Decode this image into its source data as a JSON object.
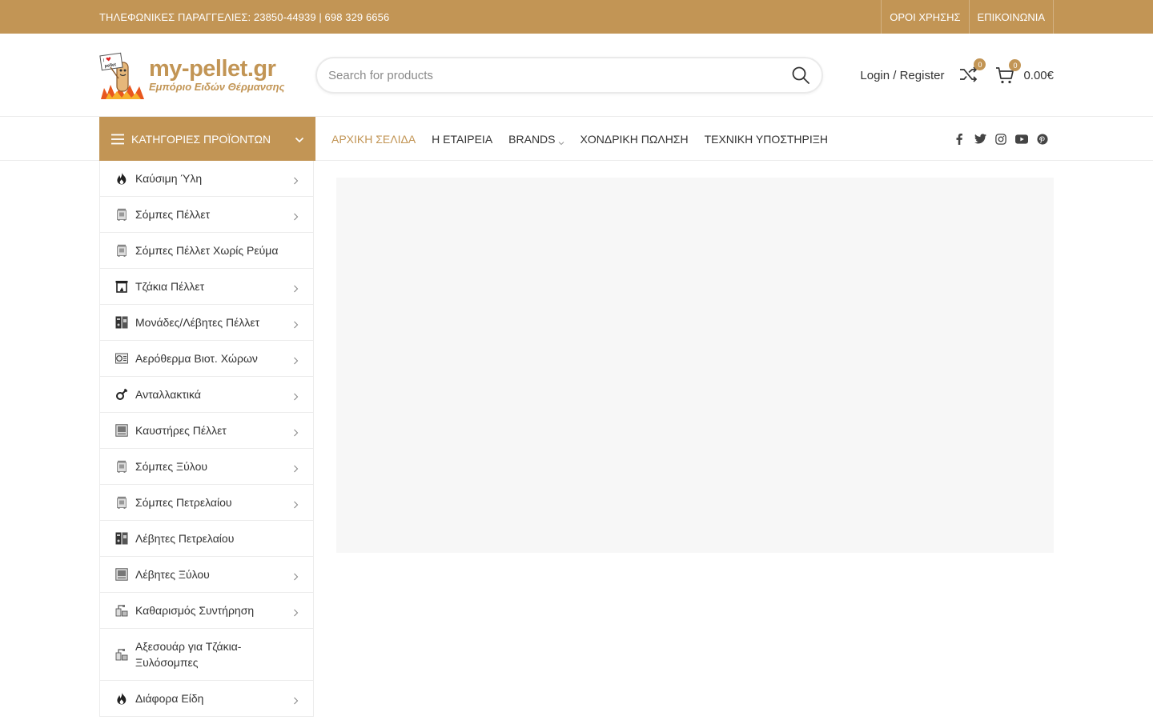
{
  "topbar": {
    "phone": "ΤΗΛΕΦΩΝΙΚΕΣ ΠΑΡΑΓΓΕΛΙΕΣ: 23850-44939 | 698 329 6656",
    "links": [
      "ΟΡΟΙ ΧΡΗΣΗΣ",
      "ΕΠΙΚΟΙΝΩΝΙΑ"
    ]
  },
  "logo": {
    "name": "my-pellet.gr",
    "subtitle": "Εμπόριο Ειδών Θέρμανσης",
    "mascot_text": "I ♥ pellet"
  },
  "search": {
    "placeholder": "Search for products"
  },
  "header": {
    "login": "Login / Register",
    "compare_count": "0",
    "cart_count": "0",
    "cart_total": "0.00€"
  },
  "nav": {
    "categories_label": "ΚΑΤΗΓΟΡΙΕΣ ΠΡΟΪΟΝΤΩΝ",
    "items": [
      "ΑΡΧΙΚΗ ΣΕΛΙΔΑ",
      "Η ΕΤΑΙΡΕΙΑ",
      "BRANDS",
      "ΧΟΝΔΡΙΚΗ ΠΩΛΗΣΗ",
      "ΤΕΧΝΙΚΗ ΥΠΟΣΤΗΡΙΞΗ"
    ],
    "socials": [
      "facebook-icon",
      "twitter-icon",
      "instagram-icon",
      "youtube-icon",
      "pinterest-icon"
    ]
  },
  "categories": [
    {
      "label": "Καύσιμη Ύλη",
      "icon": "flame-icon",
      "arrow": true
    },
    {
      "label": "Σόμπες Πέλλετ",
      "icon": "stove-icon",
      "arrow": true
    },
    {
      "label": "Σόμπες Πέλλετ Χωρίς Ρεύμα",
      "icon": "stove-icon",
      "arrow": false
    },
    {
      "label": "Τζάκια Πέλλετ",
      "icon": "fireplace-icon",
      "arrow": true
    },
    {
      "label": "Μονάδες/Λέβητες Πέλλετ",
      "icon": "boiler-icon",
      "arrow": true
    },
    {
      "label": "Αερόθερμα Βιοτ. Χώρων",
      "icon": "heater-icon",
      "arrow": true
    },
    {
      "label": "Ανταλλακτικά",
      "icon": "spare-parts-icon",
      "arrow": true
    },
    {
      "label": "Καυστήρες Πέλλετ",
      "icon": "burner-icon",
      "arrow": true
    },
    {
      "label": "Σόμπες Ξύλου",
      "icon": "stove-icon",
      "arrow": true
    },
    {
      "label": "Σόμπες Πετρελαίου",
      "icon": "stove-icon",
      "arrow": true
    },
    {
      "label": "Λέβητες Πετρελαίου",
      "icon": "boiler-icon",
      "arrow": false
    },
    {
      "label": "Λέβητες Ξύλου",
      "icon": "burner-icon",
      "arrow": true
    },
    {
      "label": "Καθαρισμός Συντήρηση",
      "icon": "cleaning-icon",
      "arrow": true
    },
    {
      "label": "Αξεσουάρ για Τζάκια-Ξυλόσομπες",
      "icon": "cleaning-icon",
      "arrow": false
    },
    {
      "label": "Διάφορα Είδη",
      "icon": "flame-icon",
      "arrow": true
    }
  ],
  "colors": {
    "accent": "#c29555",
    "text": "#333333",
    "border": "#ececec",
    "banner": "#f7f7f7"
  }
}
